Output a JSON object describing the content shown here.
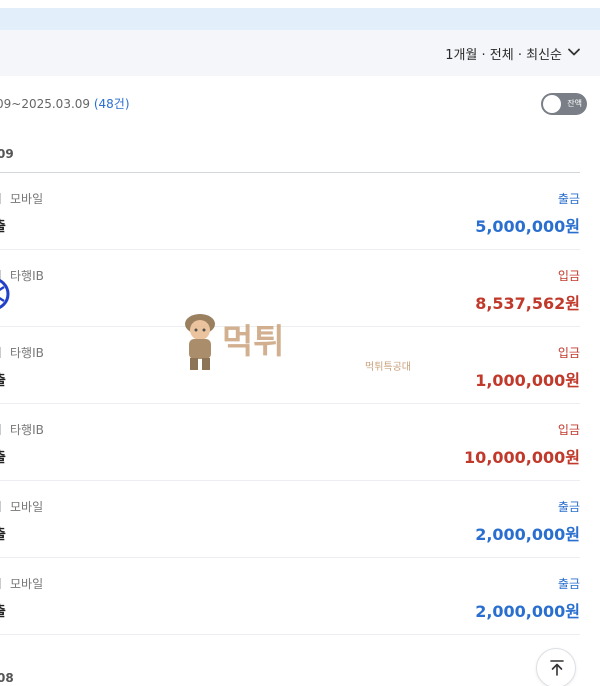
{
  "filter": {
    "label": "1개월 · 전체 · 최신순"
  },
  "summary": {
    "range": "09~2025.03.09",
    "count": "(48건)",
    "toggle_label": "잔액"
  },
  "dates": {
    "first": "09",
    "next": "08"
  },
  "transactions": [
    {
      "channel": "모바일",
      "name": "출",
      "type": "출금",
      "amount": "5,000,000원"
    },
    {
      "channel": "타행IB",
      "name": "",
      "type": "입금",
      "amount": "8,537,562원"
    },
    {
      "channel": "타행IB",
      "name": "출",
      "type": "입금",
      "amount": "1,000,000원"
    },
    {
      "channel": "타행IB",
      "name": "출",
      "type": "입금",
      "amount": "10,000,000원"
    },
    {
      "channel": "모바일",
      "name": "출",
      "type": "출금",
      "amount": "2,000,000원"
    },
    {
      "channel": "모바일",
      "name": "출",
      "type": "출금",
      "amount": "2,000,000원"
    }
  ],
  "watermark": {
    "title": "먹튀",
    "subtitle": "먹튀특공대"
  },
  "icons": {
    "filter_toggle": "chevron-down-icon",
    "scroll_top": "arrow-up-icon",
    "bank": "bank-logo-icon",
    "mascot": "soldier-mascot-icon"
  },
  "colors": {
    "withdrawal": "#2a6fcf",
    "deposit": "#c0392b",
    "header_band": "#e3eefb"
  }
}
